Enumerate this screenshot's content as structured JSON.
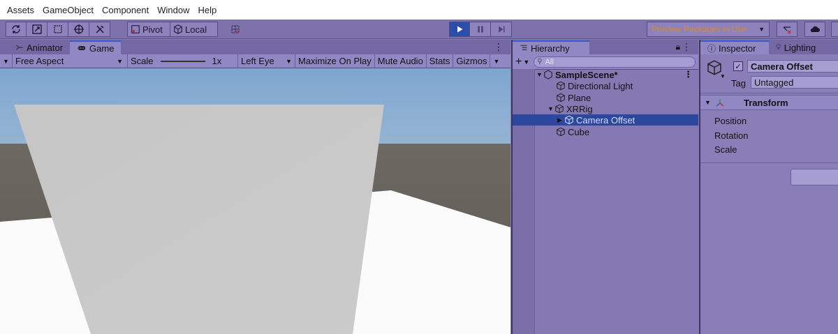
{
  "menubar": {
    "items": [
      "Assets",
      "GameObject",
      "Component",
      "Window",
      "Help"
    ]
  },
  "toolbar": {
    "pivot_label": "Pivot",
    "local_label": "Local",
    "preview_label": "Preview Packages in Use"
  },
  "game_panel": {
    "tabs": [
      {
        "label": "Animator",
        "icon": "animator-icon"
      },
      {
        "label": "Game",
        "icon": "gamepad-icon"
      }
    ],
    "aspect": "Free Aspect",
    "scale_label": "Scale",
    "scale_value": "1x",
    "eye": "Left Eye",
    "maximize": "Maximize On Play",
    "mute": "Mute Audio",
    "stats": "Stats",
    "gizmos": "Gizmos"
  },
  "hierarchy": {
    "tab_label": "Hierarchy",
    "search_placeholder": "All",
    "scene": "SampleScene*",
    "items": [
      "Directional Light",
      "Plane",
      "XRRig",
      "Camera Offset",
      "Cube"
    ]
  },
  "inspector": {
    "tabs": [
      "Inspector",
      "Lighting"
    ],
    "object_name": "Camera Offset",
    "tag_label": "Tag",
    "tag_value": "Untagged",
    "component": "Transform",
    "properties": [
      "Position",
      "Rotation",
      "Scale"
    ]
  },
  "colors": {
    "editor_bg": "#8a7fb4",
    "selection": "#2c479e",
    "play_active": "#2d4ea8",
    "preview_text": "#d28a3a"
  }
}
